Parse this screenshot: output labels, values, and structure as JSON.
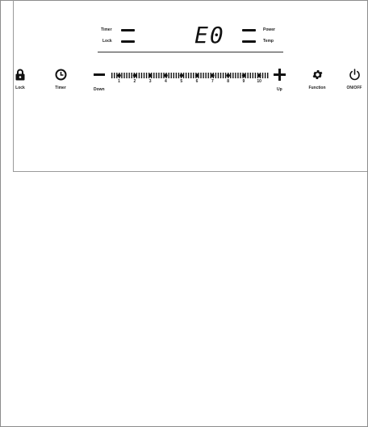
{
  "indicators": {
    "timer": "Timer",
    "lock": "Lock",
    "power": "Power",
    "temp": "Temp"
  },
  "display": {
    "code": "E0"
  },
  "controls": {
    "lock": {
      "label": "Lock",
      "icon": "padlock-icon"
    },
    "timer": {
      "label": "Timer",
      "icon": "clock-icon"
    },
    "down": {
      "label": "Down",
      "icon": "minus-icon"
    },
    "up": {
      "label": "Up",
      "icon": "plus-icon"
    },
    "function": {
      "label": "Function",
      "icon": "gear-icon"
    },
    "onoff": {
      "label": "ON/OFF",
      "icon": "power-icon"
    }
  },
  "slider": {
    "levels": [
      "1",
      "2",
      "3",
      "4",
      "5",
      "6",
      "7",
      "8",
      "9",
      "10"
    ]
  },
  "colors": {
    "ink": "#111111",
    "frame": "#8c8c8c",
    "background": "#ffffff"
  }
}
